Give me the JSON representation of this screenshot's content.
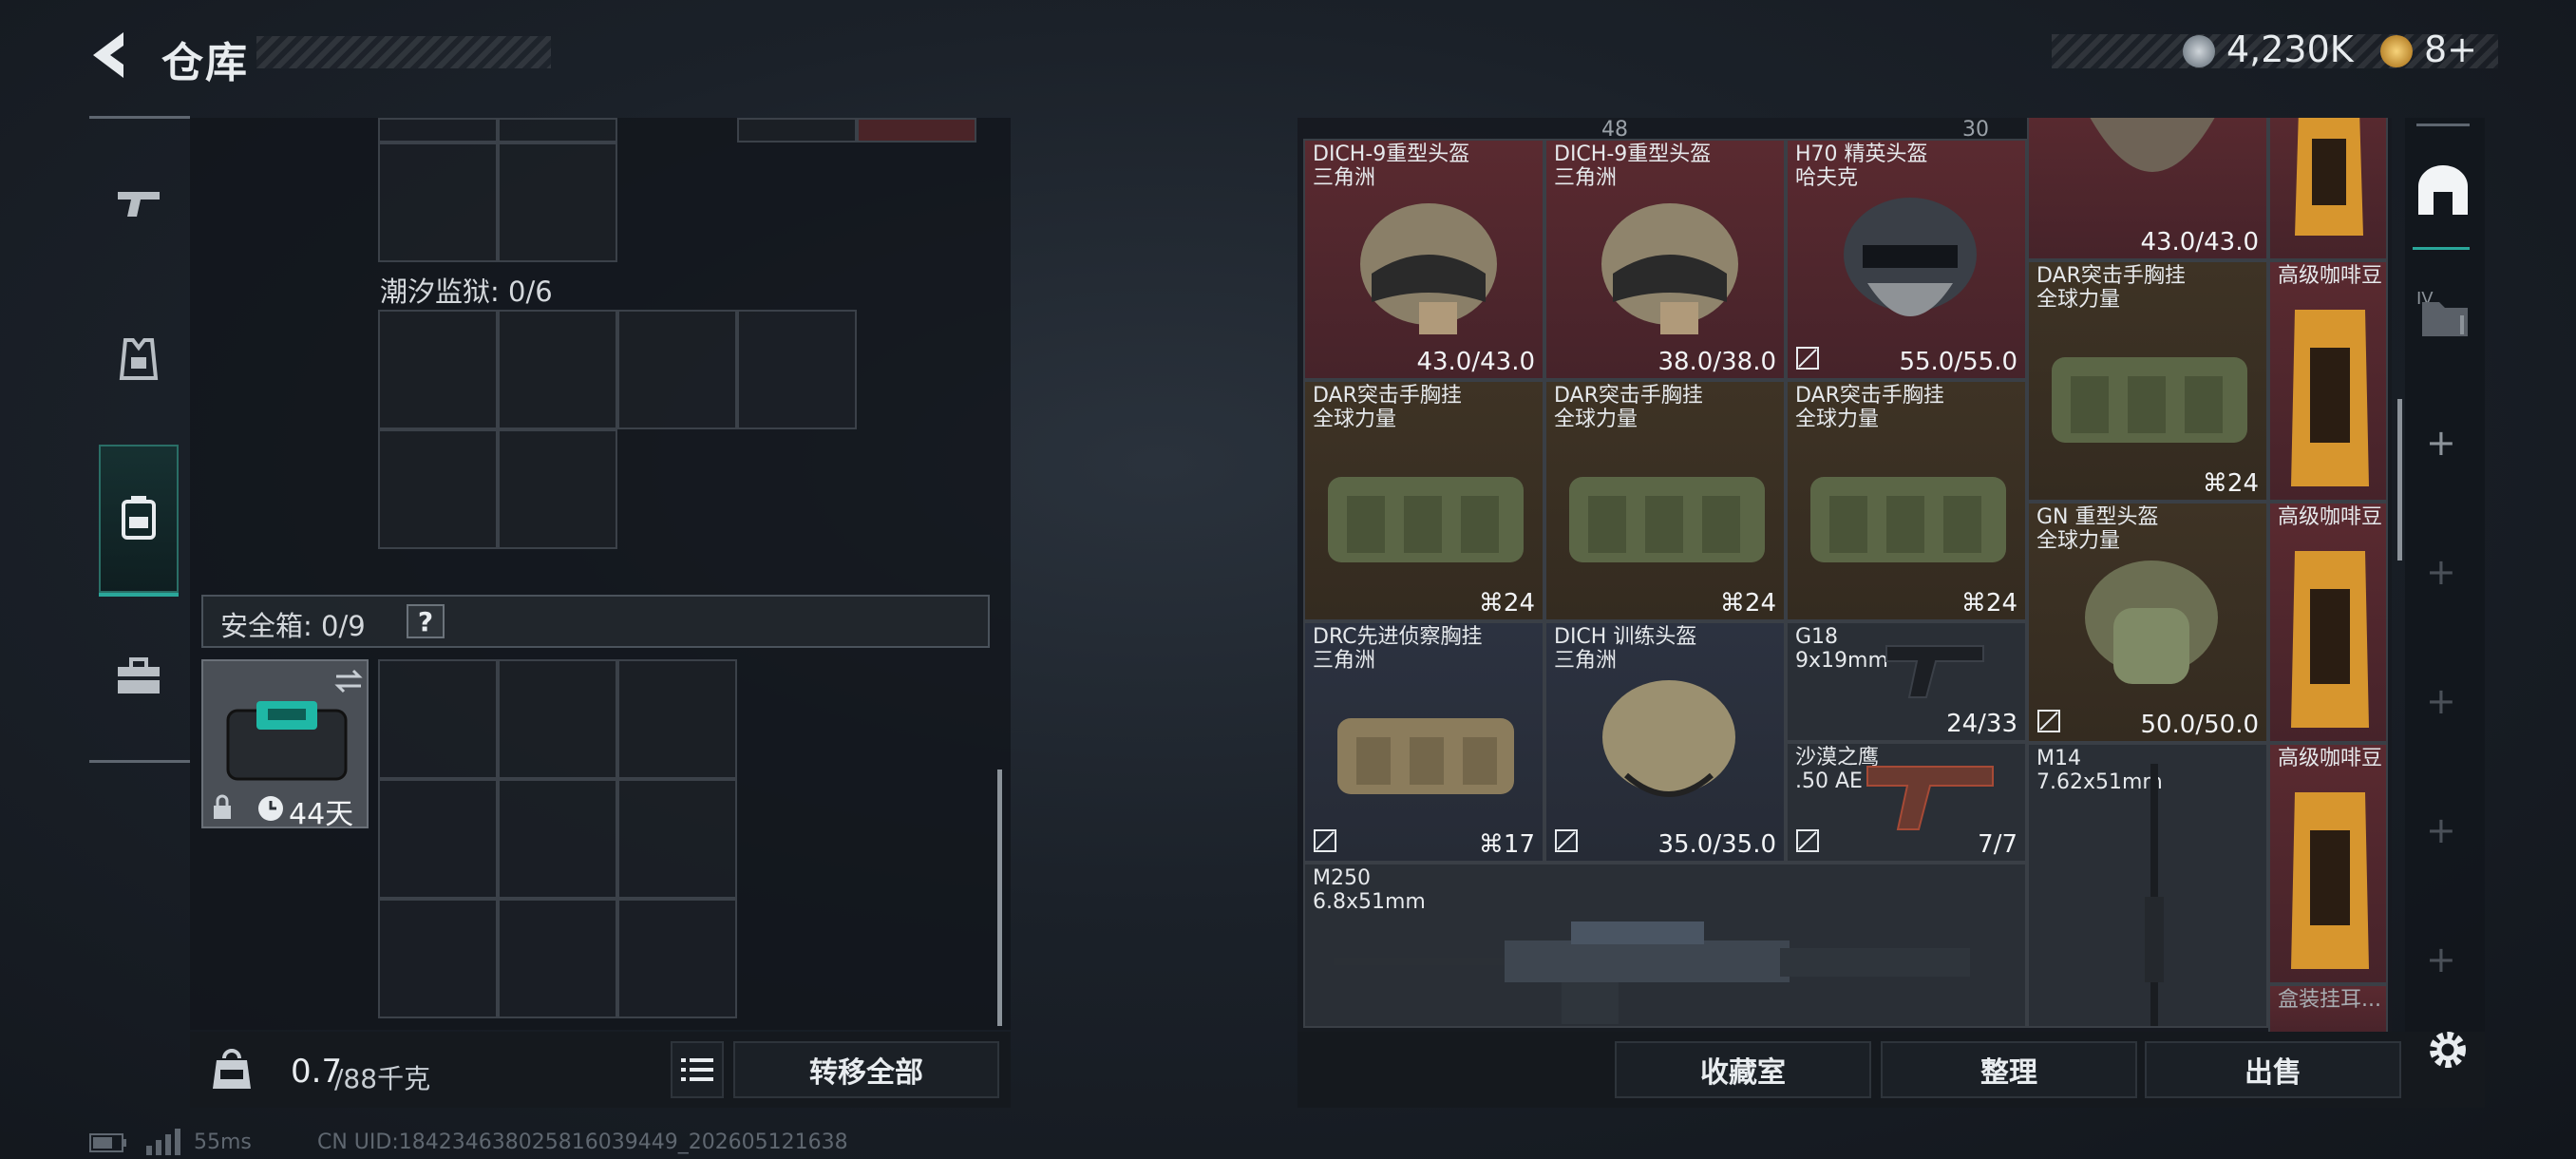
{
  "header": {
    "title": "仓库",
    "currency_amount": "4,230K",
    "ticket_count": "8+",
    "colors": {
      "coin": "#9aa4ae",
      "ticket": "#e0b04a"
    }
  },
  "sidebar": {
    "items": [
      {
        "name": "weapons-tab",
        "icon": "pistol-icon"
      },
      {
        "name": "armor-tab",
        "icon": "vest-icon"
      },
      {
        "name": "backpack-tab",
        "icon": "backpack-icon",
        "active": true
      },
      {
        "name": "toolbox-tab",
        "icon": "toolbox-icon"
      }
    ],
    "accent": "#2aa79a"
  },
  "left_panel": {
    "container_label": "潮汐监狱: 0/6",
    "safe_box_label": "安全箱: 0/9",
    "help_label": "?",
    "safe_box_days": "44天",
    "weight_current": "0.7",
    "weight_max": "/88千克",
    "transfer_all": "转移全部"
  },
  "status_bar": {
    "ping": "55ms",
    "uid": "CN UID:18423463802581603944​9_202605121638"
  },
  "items": [
    {
      "name": "DICH-9重型头盔",
      "sub": "三角洲",
      "value": "43.0/43.0"
    },
    {
      "name": "DICH-9重型头盔",
      "sub": "三角洲",
      "value": "38.0/38.0"
    },
    {
      "name": "H70 精英头盔",
      "sub": "哈夫克",
      "value": "55.0/55.0"
    },
    {
      "name": "",
      "sub": "",
      "value": "43.0/43.0"
    },
    {
      "name": "DAR突击手胸挂",
      "sub": "全球力量",
      "value": "24"
    },
    {
      "name": "DAR突击手胸挂",
      "sub": "全球力量",
      "value": "24"
    },
    {
      "name": "DAR突击手胸挂",
      "sub": "全球力量",
      "value": "24"
    },
    {
      "name": "DAR突击手胸挂",
      "sub": "全球力量",
      "value": "24"
    },
    {
      "name": "GN 重型头盔",
      "sub": "全球力量",
      "value": "50.0/50.0"
    },
    {
      "name": "DRC先进侦察胸挂",
      "sub": "三角洲",
      "value": "17"
    },
    {
      "name": "DICH 训练头盔",
      "sub": "三角洲",
      "value": "35.0/35.0"
    },
    {
      "name": "G18",
      "sub": "9x19mm",
      "value": "24/33"
    },
    {
      "name": "沙漠之鹰",
      "sub": ".50 AE",
      "value": "7/7"
    },
    {
      "name": "M14",
      "sub": "7.62x51mm",
      "value": ""
    },
    {
      "name": "M250",
      "sub": "6.8x51mm",
      "value": ""
    },
    {
      "name": "高级咖啡豆",
      "sub": "",
      "value": ""
    },
    {
      "name": "高级咖啡豆",
      "sub": "",
      "value": ""
    },
    {
      "name": "高级咖啡豆",
      "sub": "",
      "value": ""
    },
    {
      "name": "盒装挂耳...",
      "sub": "",
      "value": ""
    }
  ],
  "top_values": [
    "48",
    "30"
  ],
  "right_sidebar": {
    "tab_label": "IV"
  },
  "actions": {
    "collection": "收藏室",
    "organize": "整理",
    "sell": "出售"
  }
}
